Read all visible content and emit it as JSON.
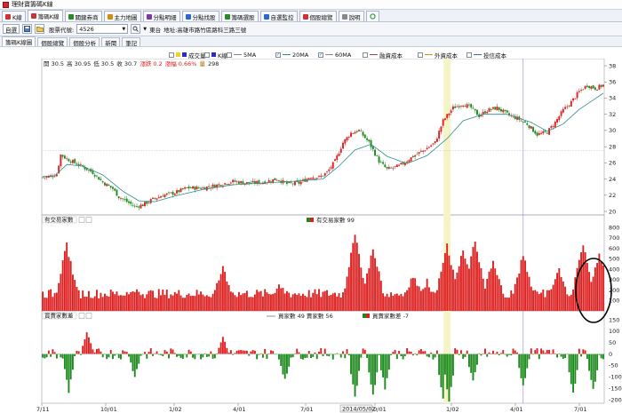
{
  "window": {
    "title": "理財寶籌碼K線"
  },
  "main_tabs": [
    {
      "label": "K線",
      "active": false,
      "color": "#c33"
    },
    {
      "label": "籌碼K線",
      "active": true,
      "color": "#c33"
    },
    {
      "label": "關鍵券商",
      "active": false,
      "color": "#2a8a2a"
    },
    {
      "label": "主力地圖",
      "active": false,
      "color": "#d58a10"
    },
    {
      "label": "分點明細",
      "active": false,
      "color": "#7a3aa8"
    },
    {
      "label": "分點找股",
      "active": false,
      "color": "#2a6ad0"
    },
    {
      "label": "籌碼選股",
      "active": false,
      "color": "#2a8a2a"
    },
    {
      "label": "自選監控",
      "active": false,
      "color": "#2a6ad0"
    },
    {
      "label": "個股總覽",
      "active": false,
      "color": "#c33"
    },
    {
      "label": "說明",
      "active": false,
      "color": "#888"
    }
  ],
  "toolbar": {
    "watchlist_label": "自選",
    "stock_code_label": "股票代號:",
    "stock_code_value": "4526",
    "company": "東台",
    "address": "地址:高雄市路竹區路科三路三號"
  },
  "sub_tabs": [
    {
      "label": "籌碼K線圖",
      "active": true
    },
    {
      "label": "個股總覽",
      "active": false
    },
    {
      "label": "個股分析",
      "active": false
    },
    {
      "label": "新聞",
      "active": false
    },
    {
      "label": "筆記",
      "active": false
    }
  ],
  "legend": [
    {
      "label": "成交量",
      "type": "swatch",
      "colors": [
        "#f2d51a",
        "#2b2bcc"
      ],
      "checked": false
    },
    {
      "label": "K線",
      "type": "swatch",
      "colors": [
        "#2b2bcc"
      ],
      "checked": false
    },
    {
      "label": "5MA",
      "type": "line",
      "color": "#888888",
      "checked": false
    },
    {
      "label": "20MA",
      "type": "line",
      "color": "#2e8b8b",
      "checked": true
    },
    {
      "label": "60MA",
      "type": "line",
      "color": "#888888",
      "checked": true
    },
    {
      "label": "融資成本",
      "type": "line",
      "color": "#a44",
      "checked": false
    },
    {
      "label": "外資成本",
      "type": "line",
      "color": "#d88b10",
      "checked": false
    },
    {
      "label": "投信成本",
      "type": "line",
      "color": "#3a66b8",
      "checked": false
    }
  ],
  "ohlc_bar": {
    "open": "開 30.5",
    "high": "高 30.95",
    "low": "低 30.5",
    "close": "收 30.7",
    "change": "漲跌 0.2",
    "change_pct": "漲幅 0.66%",
    "volume_label": "量",
    "volume": "298"
  },
  "panels": {
    "brokers_title": "有交易家數",
    "brokers_legend": "有交易家數",
    "brokers_value": "99",
    "net_title": "買賣家數差",
    "net_legend_line": "買家數",
    "net_buy_value": "49",
    "net_sell_label": "賣家數",
    "net_sell_value": "56",
    "net_legend_bar": "買賣家數差",
    "net_diff_value": "-7"
  },
  "date_badge": "2014/05/02",
  "colors": {
    "up": "#dd1f1f",
    "down": "#1d8a1d",
    "ma": "#2e8b8b",
    "highlight": "#f6f4c6",
    "vline": "#a98fd8"
  },
  "chart_data": [
    {
      "type": "candlestick",
      "title": "",
      "x_ticks": [
        "7/11",
        "10/01",
        "1/02",
        "4/01",
        "7/01",
        "10/01",
        "1/02",
        "4/01",
        "7/01"
      ],
      "ylim": [
        20,
        38
      ],
      "y_ticks": [
        20,
        22,
        24,
        26,
        28,
        30,
        32,
        34,
        36,
        38
      ],
      "close_path": [
        [
          0,
          24.2
        ],
        [
          3,
          24.3
        ],
        [
          7,
          24.6
        ],
        [
          9,
          27
        ],
        [
          12,
          26.5
        ],
        [
          16,
          26
        ],
        [
          20,
          25.5
        ],
        [
          25,
          24.8
        ],
        [
          30,
          23.6
        ],
        [
          35,
          22.8
        ],
        [
          38,
          21.8
        ],
        [
          42,
          21.2
        ],
        [
          46,
          20.6
        ],
        [
          50,
          20.8
        ],
        [
          55,
          21.5
        ],
        [
          60,
          22
        ],
        [
          66,
          22.3
        ],
        [
          72,
          22.9
        ],
        [
          80,
          22.9
        ],
        [
          88,
          23.3
        ],
        [
          95,
          23.7
        ],
        [
          102,
          23.5
        ],
        [
          110,
          23.6
        ],
        [
          117,
          24
        ],
        [
          122,
          23.4
        ],
        [
          128,
          23.5
        ],
        [
          134,
          24.3
        ],
        [
          138,
          24.2
        ],
        [
          142,
          24.8
        ],
        [
          146,
          26.2
        ],
        [
          150,
          28.5
        ],
        [
          154,
          29.7
        ],
        [
          158,
          30
        ],
        [
          163,
          28.5
        ],
        [
          168,
          26.2
        ],
        [
          172,
          25.2
        ],
        [
          178,
          25.6
        ],
        [
          185,
          26.8
        ],
        [
          190,
          27.5
        ],
        [
          196,
          28.5
        ],
        [
          200,
          31.2
        ],
        [
          205,
          32.8
        ],
        [
          210,
          33.3
        ],
        [
          214,
          32.8
        ],
        [
          218,
          31.8
        ],
        [
          222,
          32.5
        ],
        [
          227,
          32.8
        ],
        [
          232,
          32
        ],
        [
          237,
          31.5
        ],
        [
          242,
          30.8
        ],
        [
          247,
          29.5
        ],
        [
          252,
          29.8
        ],
        [
          256,
          31
        ],
        [
          260,
          32.5
        ],
        [
          264,
          33.5
        ],
        [
          268,
          34.8
        ],
        [
          272,
          35.6
        ],
        [
          276,
          35.2
        ],
        [
          280,
          35.6
        ]
      ],
      "ma20_path": [
        [
          0,
          24.3
        ],
        [
          6,
          24.4
        ],
        [
          12,
          25.8
        ],
        [
          20,
          25.6
        ],
        [
          30,
          24.5
        ],
        [
          40,
          22.5
        ],
        [
          48,
          21.3
        ],
        [
          56,
          21.2
        ],
        [
          66,
          21.9
        ],
        [
          80,
          22.7
        ],
        [
          95,
          23.3
        ],
        [
          110,
          23.5
        ],
        [
          125,
          23.7
        ],
        [
          140,
          24
        ],
        [
          148,
          25.6
        ],
        [
          156,
          27.6
        ],
        [
          164,
          28.3
        ],
        [
          172,
          26.8
        ],
        [
          182,
          25.9
        ],
        [
          192,
          26.9
        ],
        [
          202,
          29
        ],
        [
          210,
          31.2
        ],
        [
          220,
          32
        ],
        [
          232,
          32
        ],
        [
          244,
          31
        ],
        [
          252,
          29.9
        ],
        [
          260,
          30.8
        ],
        [
          268,
          32.6
        ],
        [
          280,
          34.6
        ]
      ],
      "ma60_level": 27.5,
      "highlight_index": 202,
      "vline_index": 240
    },
    {
      "type": "bar",
      "title": "有交易家數",
      "ylim": [
        0,
        800
      ],
      "y_ticks": [
        100,
        200,
        300,
        400,
        500,
        600,
        700,
        800
      ],
      "peaks": [
        [
          12,
          600
        ],
        [
          45,
          150
        ],
        [
          90,
          380
        ],
        [
          118,
          230
        ],
        [
          156,
          720
        ],
        [
          165,
          560
        ],
        [
          185,
          310
        ],
        [
          192,
          250
        ],
        [
          202,
          600
        ],
        [
          210,
          560
        ],
        [
          216,
          650
        ],
        [
          225,
          450
        ],
        [
          240,
          500
        ],
        [
          258,
          360
        ],
        [
          270,
          620
        ],
        [
          278,
          530
        ]
      ],
      "baseline": 120
    },
    {
      "type": "bar",
      "title": "買賣家數差",
      "ylim": [
        -200,
        150
      ],
      "y_ticks": [
        150,
        100,
        50,
        0,
        -50,
        -100,
        -150,
        -200
      ],
      "spikes": [
        [
          13,
          -165
        ],
        [
          22,
          95
        ],
        [
          46,
          -95
        ],
        [
          90,
          75
        ],
        [
          121,
          -115
        ],
        [
          156,
          -190
        ],
        [
          165,
          -185
        ],
        [
          171,
          -150
        ],
        [
          200,
          -200
        ],
        [
          203,
          -210
        ],
        [
          215,
          -120
        ],
        [
          240,
          -140
        ],
        [
          265,
          -175
        ],
        [
          275,
          -160
        ]
      ]
    }
  ]
}
